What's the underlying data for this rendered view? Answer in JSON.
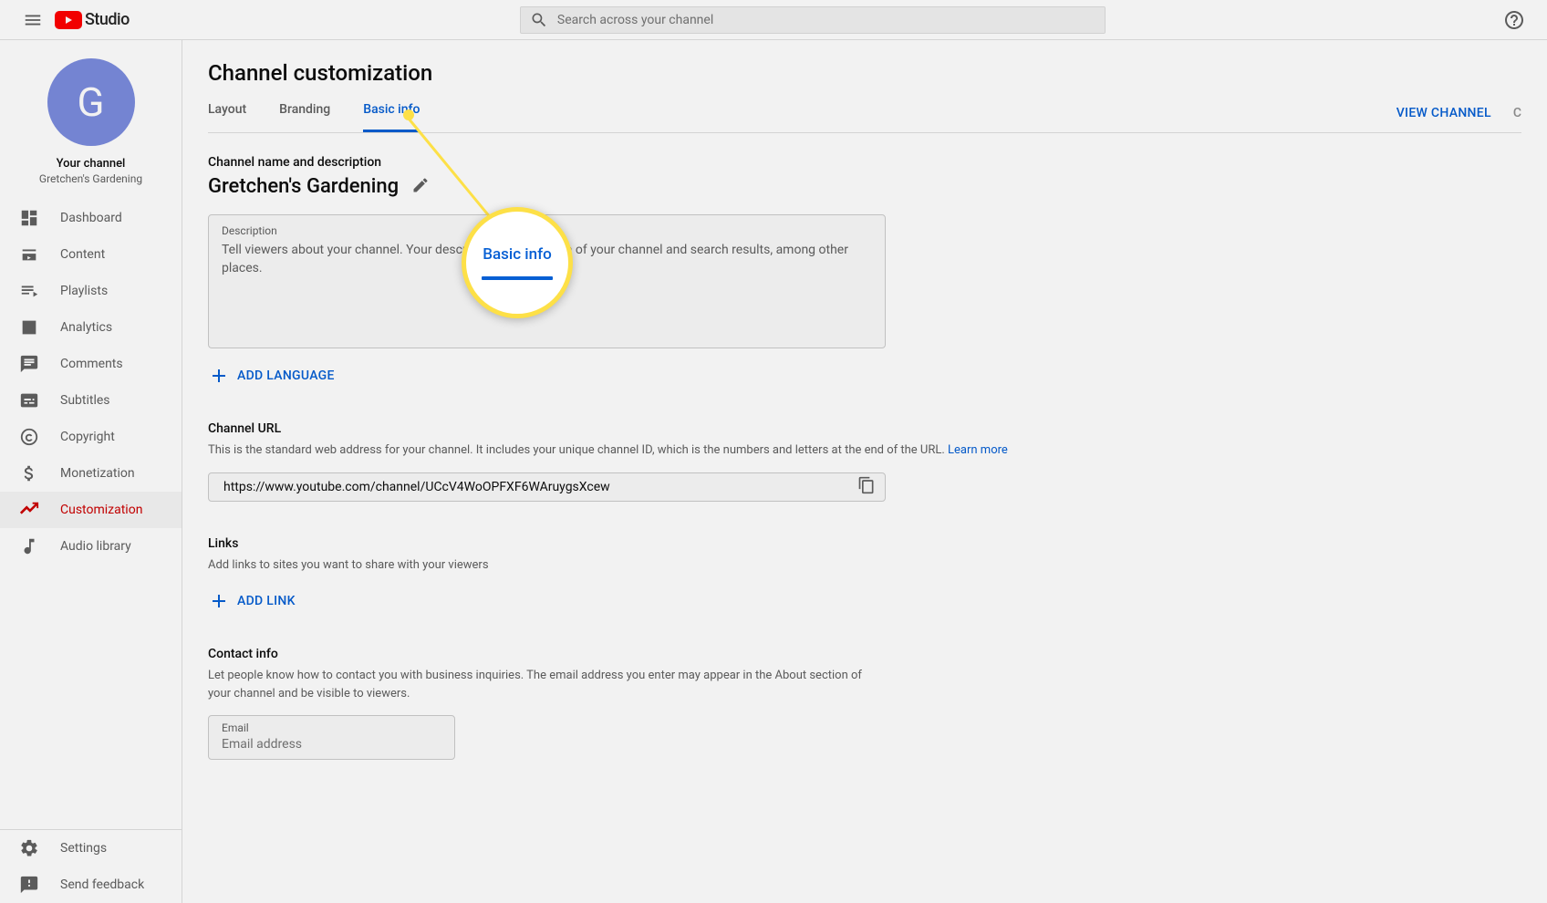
{
  "header": {
    "logo_text": "Studio",
    "search_placeholder": "Search across your channel"
  },
  "sidebar": {
    "avatar_letter": "G",
    "channel_title": "Your channel",
    "channel_name": "Gretchen's Gardening",
    "items": [
      {
        "label": "Dashboard"
      },
      {
        "label": "Content"
      },
      {
        "label": "Playlists"
      },
      {
        "label": "Analytics"
      },
      {
        "label": "Comments"
      },
      {
        "label": "Subtitles"
      },
      {
        "label": "Copyright"
      },
      {
        "label": "Monetization"
      },
      {
        "label": "Customization"
      },
      {
        "label": "Audio library"
      }
    ],
    "footer": [
      {
        "label": "Settings"
      },
      {
        "label": "Send feedback"
      }
    ]
  },
  "page": {
    "title": "Channel customization",
    "tabs": [
      {
        "label": "Layout"
      },
      {
        "label": "Branding"
      },
      {
        "label": "Basic info"
      }
    ],
    "view_channel": "VIEW CHANNEL",
    "truncated": "C"
  },
  "basic_info": {
    "name_section_label": "Channel name and description",
    "name_value": "Gretchen's Gardening",
    "desc_label": "Description",
    "desc_placeholder": "Tell viewers about your channel. Your description                         bout section of your channel and search results, among other places.",
    "add_language": "ADD LANGUAGE",
    "url_label": "Channel URL",
    "url_desc": "This is the standard web address for your channel. It includes your unique channel ID, which is the numbers and letters at the end of the URL.",
    "learn_more": "Learn more",
    "url_value": "https://www.youtube.com/channel/UCcV4WoOPFXF6WAruygsXcew",
    "links_label": "Links",
    "links_desc": "Add links to sites you want to share with your viewers",
    "add_link": "ADD LINK",
    "contact_label": "Contact info",
    "contact_desc": "Let people know how to contact you with business inquiries. The email address you enter may appear in the About section of your channel and be visible to viewers.",
    "email_label": "Email",
    "email_placeholder": "Email address"
  },
  "callout": {
    "text": "Basic info"
  }
}
